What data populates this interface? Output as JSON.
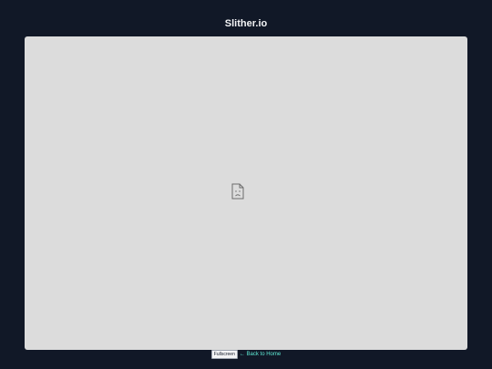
{
  "header": {
    "title": "Slither.io"
  },
  "game_frame": {
    "content_icon": "broken-image-icon"
  },
  "footer": {
    "fullscreen_label": "Fullscreen",
    "back_link_label": "← Back to Home"
  },
  "colors": {
    "background": "#111827",
    "frame": "#dcdcdc",
    "link": "#5eead4"
  }
}
